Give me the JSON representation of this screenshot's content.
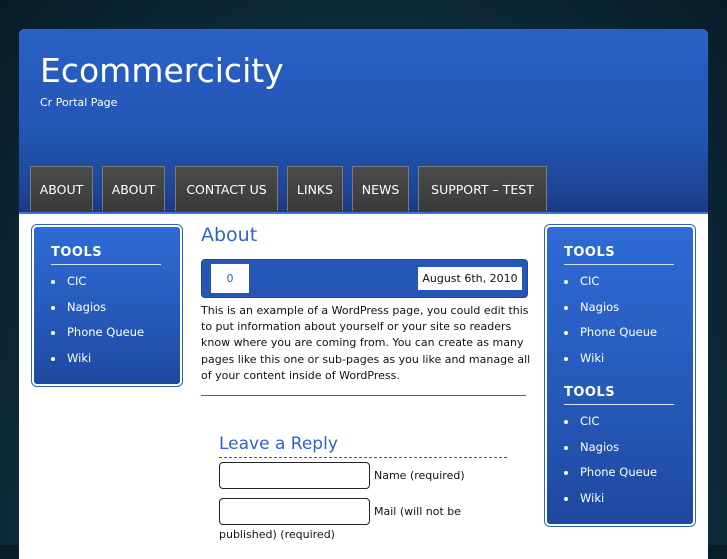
{
  "site": {
    "title": "Ecommercicity",
    "tagline": "Cr Portal Page"
  },
  "nav": {
    "items": [
      {
        "label": "About"
      },
      {
        "label": "About"
      },
      {
        "label": "Contact Us"
      },
      {
        "label": "Links"
      },
      {
        "label": "News"
      },
      {
        "label": "Support – Test"
      }
    ]
  },
  "left_sidebar": {
    "widgets": [
      {
        "title": "TOOLS",
        "links": [
          "CIC",
          "Nagios",
          "Phone Queue",
          "Wiki"
        ]
      }
    ]
  },
  "right_sidebar": {
    "widgets": [
      {
        "title": "TOOLS",
        "links": [
          "CIC",
          "Nagios",
          "Phone Queue",
          "Wiki"
        ]
      },
      {
        "title": "TOOLS",
        "links": [
          "CIC",
          "Nagios",
          "Phone Queue",
          "Wiki"
        ]
      }
    ]
  },
  "post": {
    "title": "About",
    "comment_count": "0",
    "date": "August 6th, 2010",
    "body": "This is an example of a WordPress page, you could edit this to put information about yourself or your site so readers know where you are coming from. You can create as many pages like this one or sub-pages as you like and manage all of your content inside of WordPress."
  },
  "reply": {
    "title": "Leave a Reply",
    "name_label": "Name (required)",
    "mail_label_line1": "Mail (will not be",
    "mail_label_line2": "published) (required)",
    "name_value": "",
    "mail_value": ""
  },
  "colors": {
    "header_blue": "#2a61c6",
    "link_blue": "#2f63c5",
    "tab_gray": "#444444"
  }
}
